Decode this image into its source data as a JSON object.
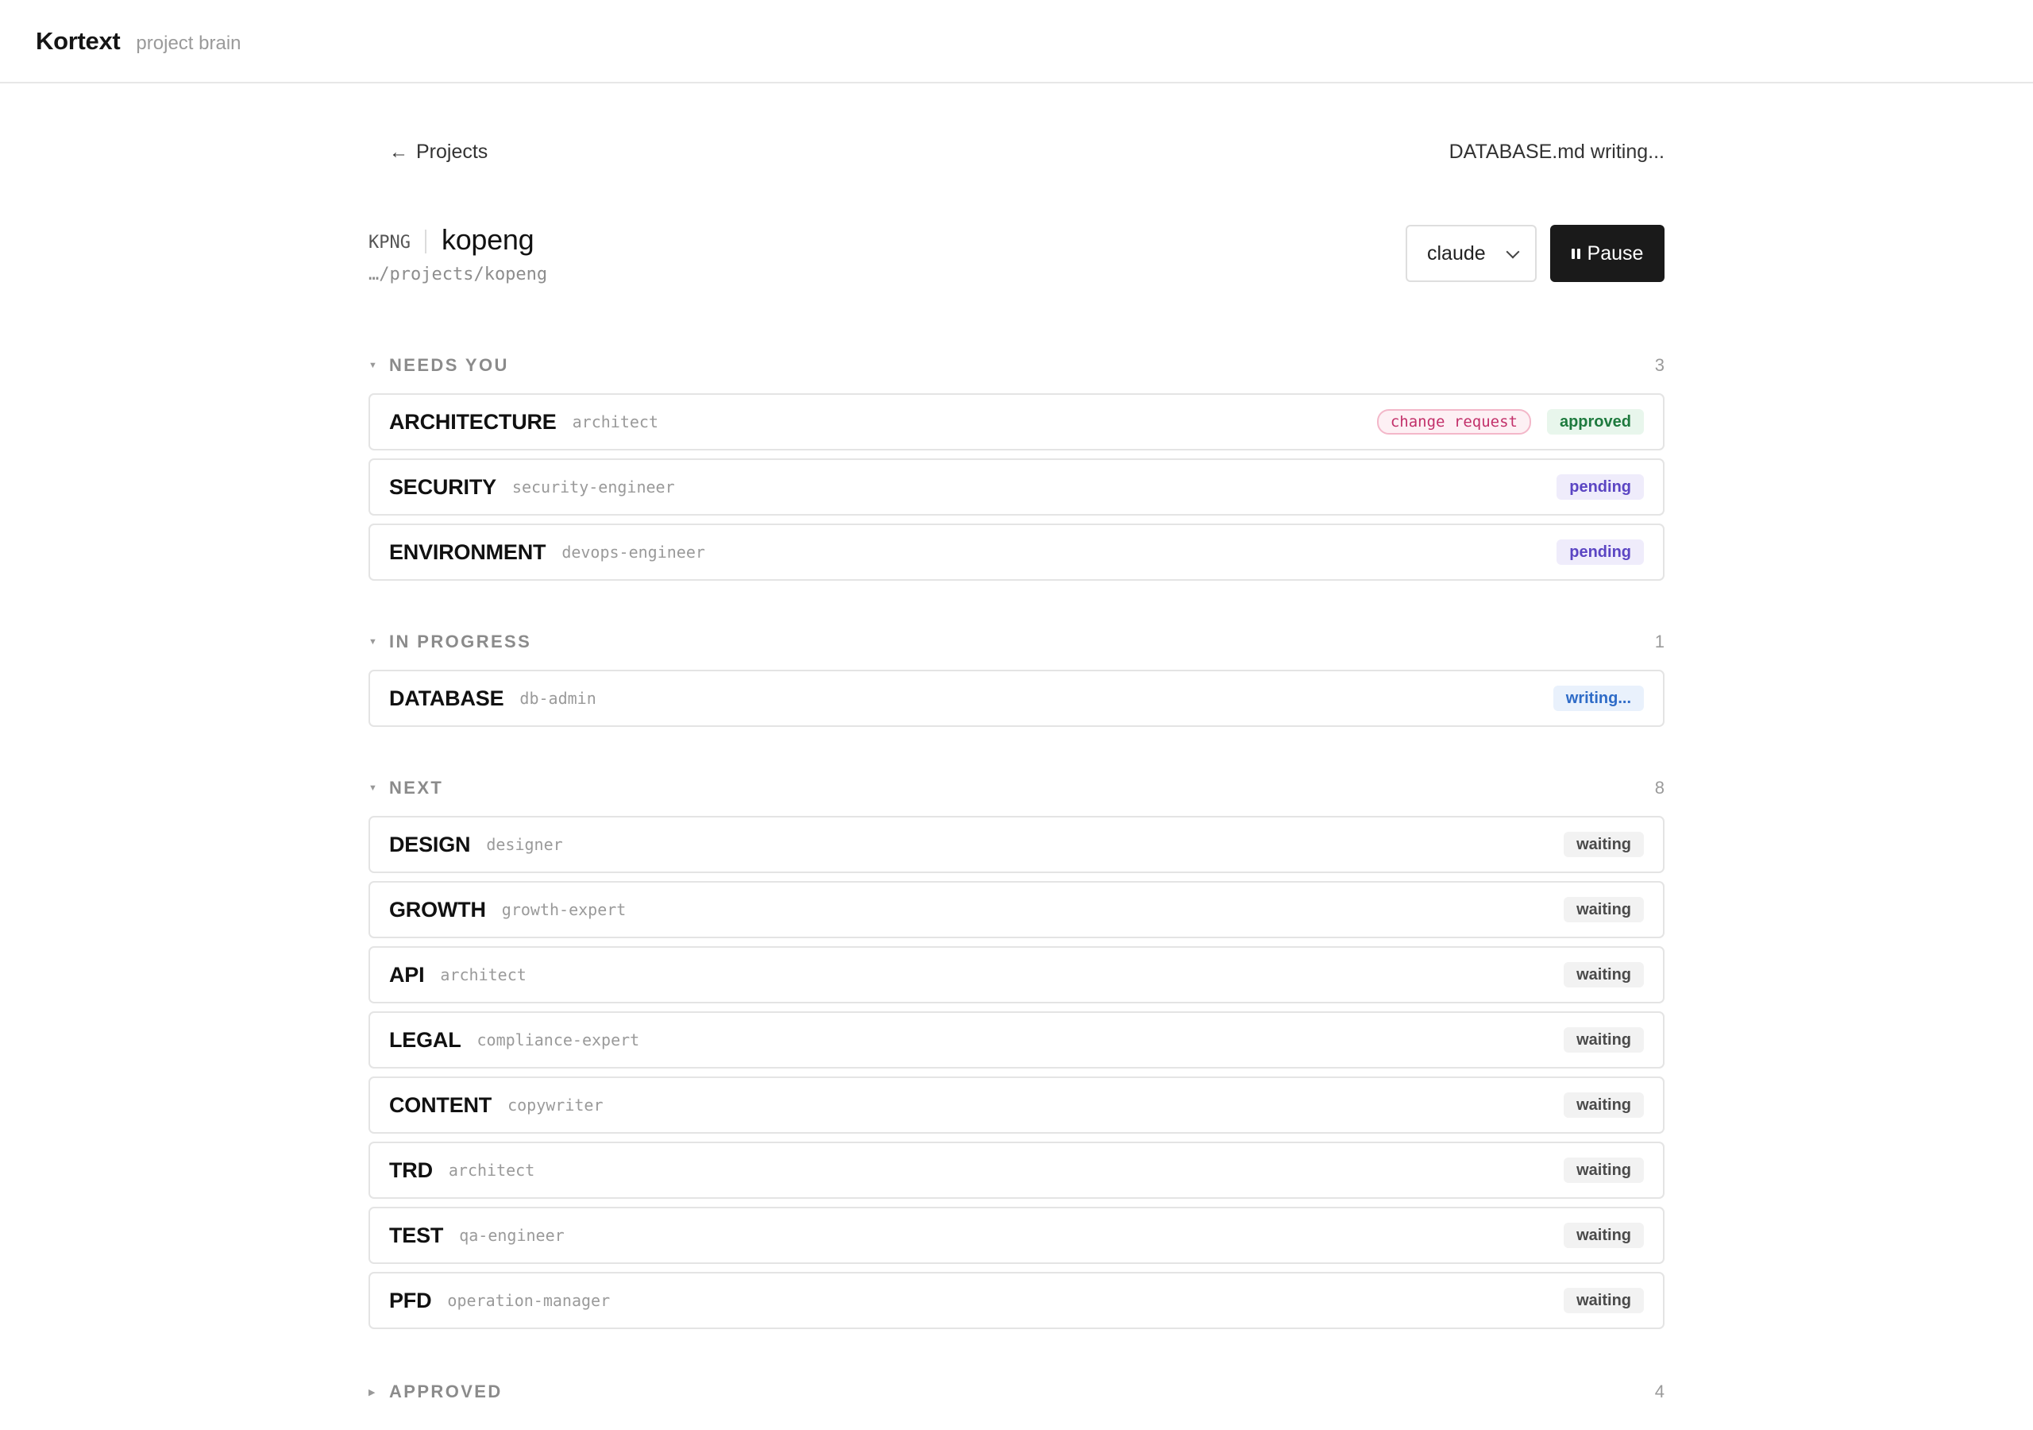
{
  "app": {
    "brand": "Kortext",
    "subtitle": "project brain"
  },
  "nav": {
    "back_label": "Projects",
    "status": "DATABASE.md writing..."
  },
  "project": {
    "code": "KPNG",
    "name": "kopeng",
    "path": "…/projects/kopeng",
    "model": "claude",
    "pause_label": "Pause"
  },
  "sections": {
    "needs_you": {
      "title": "NEEDS YOU",
      "count": "3",
      "rows": [
        {
          "title": "ARCHITECTURE",
          "role": "architect",
          "badges": [
            {
              "label": "change request",
              "kind": "change"
            },
            {
              "label": "approved",
              "kind": "approved"
            }
          ]
        },
        {
          "title": "SECURITY",
          "role": "security-engineer",
          "badges": [
            {
              "label": "pending",
              "kind": "pending"
            }
          ]
        },
        {
          "title": "ENVIRONMENT",
          "role": "devops-engineer",
          "badges": [
            {
              "label": "pending",
              "kind": "pending"
            }
          ]
        }
      ]
    },
    "in_progress": {
      "title": "IN PROGRESS",
      "count": "1",
      "rows": [
        {
          "title": "DATABASE",
          "role": "db-admin",
          "badges": [
            {
              "label": "writing...",
              "kind": "writing"
            }
          ]
        }
      ]
    },
    "next": {
      "title": "NEXT",
      "count": "8",
      "rows": [
        {
          "title": "DESIGN",
          "role": "designer",
          "badges": [
            {
              "label": "waiting",
              "kind": "waiting"
            }
          ]
        },
        {
          "title": "GROWTH",
          "role": "growth-expert",
          "badges": [
            {
              "label": "waiting",
              "kind": "waiting"
            }
          ]
        },
        {
          "title": "API",
          "role": "architect",
          "badges": [
            {
              "label": "waiting",
              "kind": "waiting"
            }
          ]
        },
        {
          "title": "LEGAL",
          "role": "compliance-expert",
          "badges": [
            {
              "label": "waiting",
              "kind": "waiting"
            }
          ]
        },
        {
          "title": "CONTENT",
          "role": "copywriter",
          "badges": [
            {
              "label": "waiting",
              "kind": "waiting"
            }
          ]
        },
        {
          "title": "TRD",
          "role": "architect",
          "badges": [
            {
              "label": "waiting",
              "kind": "waiting"
            }
          ]
        },
        {
          "title": "TEST",
          "role": "qa-engineer",
          "badges": [
            {
              "label": "waiting",
              "kind": "waiting"
            }
          ]
        },
        {
          "title": "PFD",
          "role": "operation-manager",
          "badges": [
            {
              "label": "waiting",
              "kind": "waiting"
            }
          ]
        }
      ]
    },
    "approved": {
      "title": "APPROVED",
      "count": "4",
      "rows": []
    }
  }
}
